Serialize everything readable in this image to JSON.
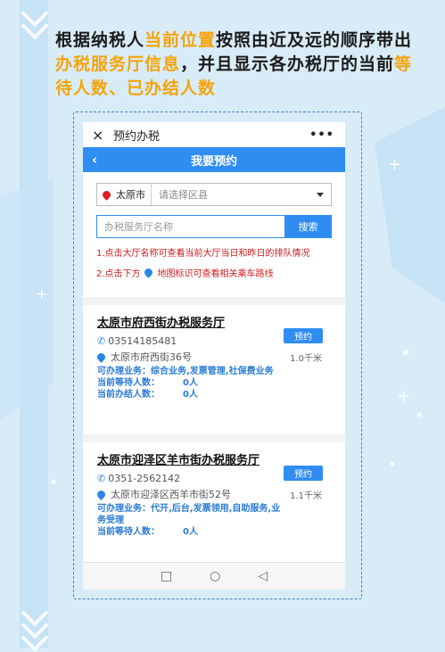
{
  "headline": {
    "p1": "根据纳税人",
    "h1": "当前位置",
    "p2": "按照由近及远的顺序带出",
    "h2": "办税服务厅信息",
    "p3": "，并且显示各办税厅的当前",
    "h3": "等待人数、已办结人数"
  },
  "miniapp": {
    "close": "×",
    "title": "预约办税",
    "menu": "•••"
  },
  "nav": {
    "back": "‹",
    "title": "我要预约"
  },
  "location": {
    "city": "太原市",
    "district_placeholder": "请选择区县"
  },
  "search": {
    "placeholder": "办税服务厅名称",
    "button": "搜索"
  },
  "tips": {
    "tip1": "1.点击大厅名称可查看当前大厅当日和昨日的排队情况",
    "tip2_pre": "2.点击下方",
    "tip2_post": "地图标识可查看相关乘车路线"
  },
  "halls": [
    {
      "name": "太原市府西街办税服务厅",
      "phone": "03514185481",
      "address": "太原市府西街36号",
      "distance": "1.0千米",
      "business": "可办理业务：综合业务,发票管理,社保费业务",
      "waiting_label": "当前等待人数：",
      "waiting": "0人",
      "done_label": "当前办结人数：",
      "done": "0人",
      "book": "预约"
    },
    {
      "name": "太原市迎泽区羊市街办税服务厅",
      "phone": "0351-2562142",
      "address": "太原市迎泽区西羊市街52号",
      "distance": "1.1千米",
      "business": "可办理业务：代开,后台,发票领用,自助服务,业务受理",
      "waiting_label": "当前等待人数：",
      "waiting": "0人",
      "book": "预约"
    }
  ],
  "system_nav": {
    "recent": "□",
    "home": "○",
    "back": "◁"
  },
  "colors": {
    "accent": "#2f8df2",
    "highlight": "#f5a30a",
    "tip": "#d01b1b",
    "info": "#2a7bd6"
  }
}
